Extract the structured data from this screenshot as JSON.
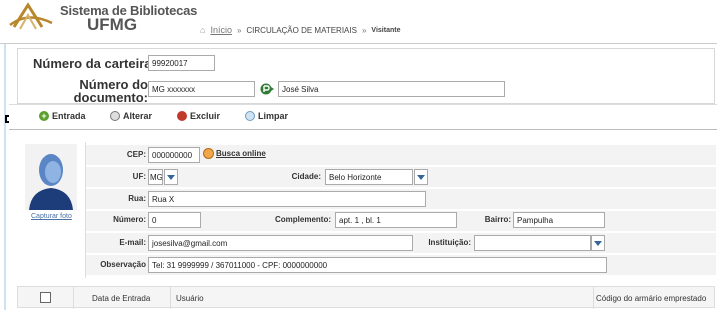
{
  "header": {
    "brand_line1": "Sistema de Bibliotecas",
    "brand_line2": "UFMG",
    "breadcrumb": {
      "home_label": "Início",
      "sep1": "»",
      "section": "CIRCULAÇÃO DE MATERIAIS",
      "sep2": "»",
      "visitor": "Visitante"
    }
  },
  "card": {
    "card_label": "Número da carteira:",
    "card_value": "99920017",
    "doc_label_line1": "Número do",
    "doc_label_line2": "documento:",
    "doc_value": "MG xxxxxxx",
    "name_value": "José Silva"
  },
  "actions": {
    "entrada": "Entrada",
    "alterar": "Alterar",
    "excluir": "Excluir",
    "limpar": "Limpar"
  },
  "photo": {
    "capture_label": "Capturar foto"
  },
  "form": {
    "cep_label": "CEP:",
    "cep_value": "000000000",
    "busca_label": "Busca online",
    "uf_label": "UF:",
    "uf_value": "MG",
    "cidade_label": "Cidade:",
    "cidade_value": "Belo Horizonte",
    "rua_label": "Rua:",
    "rua_value": "Rua X",
    "numero_label": "Número:",
    "numero_value": "0",
    "complemento_label": "Complemento:",
    "complemento_value": "apt. 1 , bl. 1",
    "bairro_label": "Bairro:",
    "bairro_value": "Pampulha",
    "email_label": "E-mail:",
    "email_value": "josesilva@gmail.com",
    "instituicao_label": "Instituição:",
    "instituicao_value": "",
    "observacao_label": "Observação",
    "observacao_value": "Tel: 31 9999999 / 367011000 - CPF: 0000000000"
  },
  "table": {
    "columns": [
      "Data de Entrada",
      "Usuário",
      "Código do armário emprestado"
    ]
  },
  "colors": {
    "accent": "#336699",
    "brand_gold": "#b8862b",
    "add_green": "#5aa02c",
    "delete_red": "#c0392b"
  }
}
